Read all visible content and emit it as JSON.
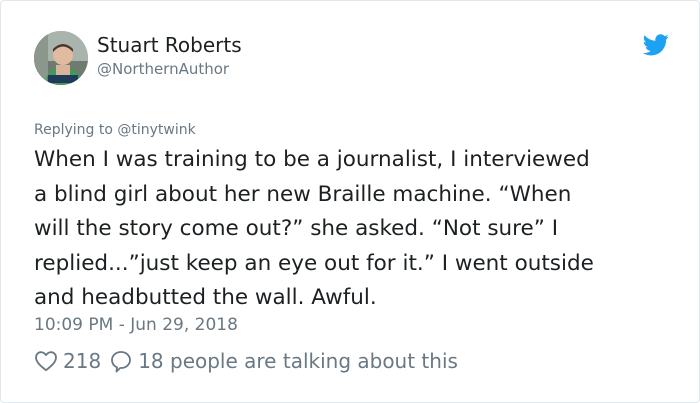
{
  "author": {
    "display_name": "Stuart Roberts",
    "handle": "@NorthernAuthor"
  },
  "tweet": {
    "replying_to": "Replying to @tinytwink",
    "text_lines": [
      "When I was training to be a journalist, I interviewed",
      "a blind girl about her new Braille machine. “When",
      "will the story come out?” she asked. “Not sure” I",
      "replied...”just keep an eye out for it.” I went outside",
      "and headbutted the wall. Awful."
    ],
    "timestamp": "10:09 PM - Jun 29, 2018"
  },
  "engagement": {
    "likes": "218",
    "talking": "18 people are talking about this"
  },
  "colors": {
    "twitter_blue": "#1da1f2",
    "meta_gray": "#697882",
    "text_dark": "#1c2022",
    "border": "#e1e8ed"
  },
  "icons": {
    "brand": "twitter-bird-icon",
    "like": "heart-outline-icon",
    "reply": "speech-bubble-icon"
  }
}
